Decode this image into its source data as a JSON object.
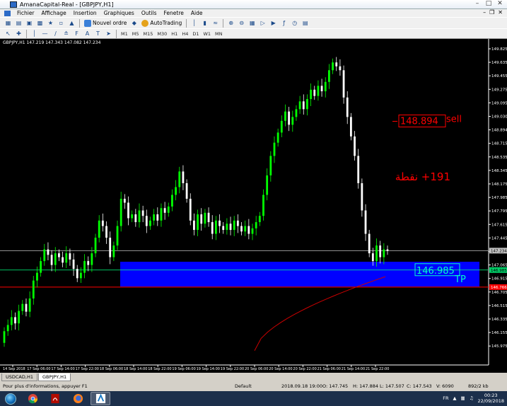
{
  "window": {
    "title": "AmanaCapital-Real - [GBPJPY,H1]"
  },
  "menu": {
    "items": [
      "Fichier",
      "Affichage",
      "Insertion",
      "Graphiques",
      "Outils",
      "Fenetre",
      "Aide"
    ]
  },
  "toolbar": {
    "new_order": "Nouvel ordre",
    "autotrading": "AutoTrading",
    "timeframes": [
      "M1",
      "M5",
      "M15",
      "M30",
      "H1",
      "H4",
      "D1",
      "W1",
      "MN"
    ]
  },
  "chart": {
    "header": "GBPJPY,H1  147.219 147.343 147.082 147.234",
    "symbol": "GBPJPY",
    "timeframe": "H1",
    "ohlc": {
      "open": 147.219,
      "high": 147.343,
      "low": 147.082,
      "close": 147.234
    },
    "price_axis": [
      "149.825",
      "149.635",
      "149.455",
      "149.275",
      "149.095",
      "149.030",
      "148.894",
      "148.715",
      "148.535",
      "148.345",
      "148.175",
      "147.985",
      "147.795",
      "147.615",
      "147.445",
      "147.255",
      "147.065",
      "146.915",
      "146.705",
      "146.515",
      "146.335",
      "146.155",
      "145.975"
    ],
    "time_axis": [
      "14 Sep 2018",
      "17 Sep 06:00",
      "17 Sep 14:00",
      "17 Sep 22:00",
      "18 Sep 06:00",
      "18 Sep 14:00",
      "18 Sep 22:00",
      "19 Sep 06:00",
      "19 Sep 14:00",
      "19 Sep 22:00",
      "20 Sep 06:00",
      "20 Sep 14:00",
      "20 Sep 22:00",
      "21 Sep 06:00",
      "21 Sep 14:00",
      "21 Sep 22:00"
    ],
    "current_price_label": "147.234",
    "green_line_label": "146.985",
    "red_line_label": "146.766",
    "annotations": {
      "sell_price": "148.894",
      "sell_text": "sell",
      "points_text": "191+ نقطة",
      "tp_price": "146.985",
      "tp_text": "TP"
    },
    "colors": {
      "bull": "#00ff00",
      "bear": "#ffffff",
      "tp_zone": "#0000ff",
      "ma": "#cc0000",
      "annotation": "#ff0000"
    }
  },
  "tabs": [
    "USDCAD,H1",
    "GBPJPY,H1"
  ],
  "status": {
    "help": "Pour plus d'informations, appuyer F1",
    "profile": "Default",
    "datetime": "2018.09.18 19:00",
    "open": "O: 147.745",
    "high": "H: 147.884",
    "low": "L: 147.507",
    "close": "C: 147.543",
    "volume": "V: 6090",
    "traffic": "892/2 kb"
  },
  "taskbar": {
    "lang": "FR",
    "time": "00:23",
    "date": "22/09/2018"
  }
}
